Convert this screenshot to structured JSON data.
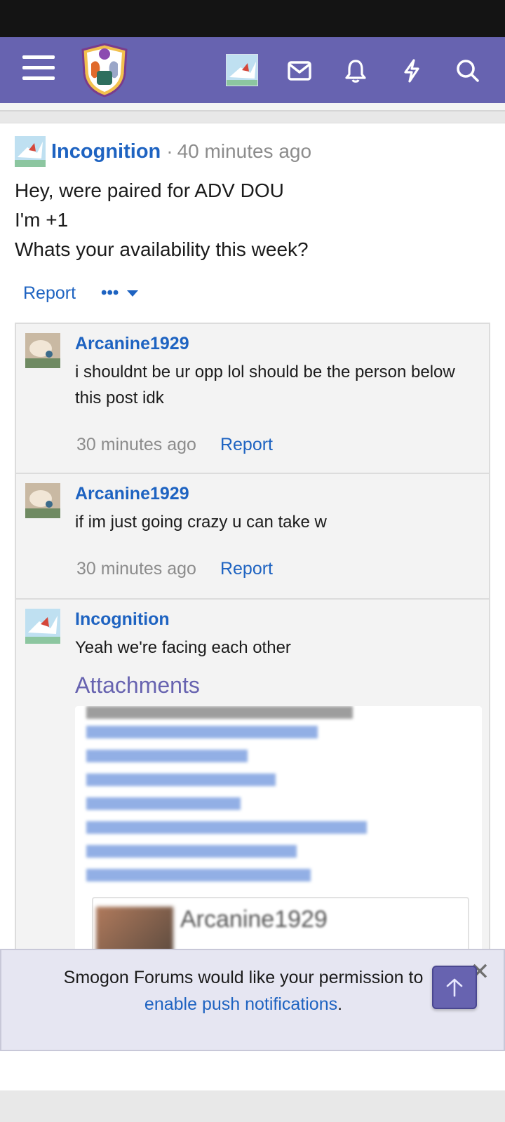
{
  "header": {
    "menu_icon": "hamburger-icon",
    "logo_icon": "smogon-logo",
    "avatar_icon": "user-avatar",
    "mail_icon": "envelope-icon",
    "alerts_icon": "bell-icon",
    "whats_new_icon": "lightning-icon",
    "search_icon": "search-icon",
    "color": "#6763b0"
  },
  "post": {
    "author": "Incognition",
    "separator": "·",
    "time": "40 minutes ago",
    "body_lines": [
      "Hey, were paired for ADV DOU",
      "I'm +1",
      "Whats your availability this week?"
    ],
    "report_label": "Report",
    "more_label": "•••"
  },
  "comments": [
    {
      "author": "Arcanine1929",
      "text": "i shouldnt be ur opp lol should be the person below this post idk",
      "time": "30 minutes ago",
      "report_label": "Report"
    },
    {
      "author": "Arcanine1929",
      "text": "if im just going crazy u can take w",
      "time": "30 minutes ago",
      "report_label": "Report"
    },
    {
      "author": "Incognition",
      "text": "Yeah we're facing each other",
      "attachments_label": "Attachments",
      "attachment_card_name": "Arcanine1929"
    }
  ],
  "push_banner": {
    "text": "Smogon Forums would like your permission to",
    "link": "enable push notifications",
    "suffix": ".",
    "close_label": "✕",
    "scroll_top_icon": "arrow-up-icon"
  },
  "colors": {
    "accent": "#6763b0",
    "link": "#1e63c1",
    "muted": "#8c8c8c"
  }
}
